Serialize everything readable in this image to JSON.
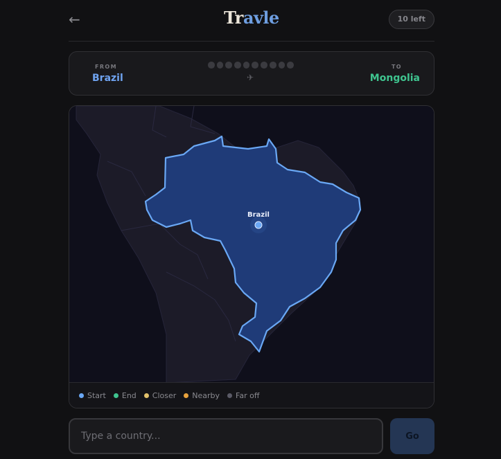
{
  "header": {
    "back_icon": "←",
    "logo_part1": "Tr",
    "logo_part2": "avle",
    "remaining": "10 left"
  },
  "route": {
    "from_label": "FROM",
    "from_value": "Brazil",
    "to_label": "TO",
    "to_value": "Mongolia",
    "guess_slots": 10,
    "plane_icon": "✈"
  },
  "map": {
    "highlight_label": "Brazil",
    "highlight_color": "#6aa8f5"
  },
  "legend": [
    {
      "label": "Start",
      "color": "#6aa8f5"
    },
    {
      "label": "End",
      "color": "#3fc48f"
    },
    {
      "label": "Closer",
      "color": "#e2c16b"
    },
    {
      "label": "Nearby",
      "color": "#e8a23d"
    },
    {
      "label": "Far off",
      "color": "#5a5a66"
    }
  ],
  "input": {
    "placeholder": "Type a country...",
    "value": ""
  },
  "go_button": {
    "label": "Go"
  },
  "colors": {
    "background": "#111113",
    "accent_blue": "#6fa3f0",
    "accent_green": "#3fc48f"
  }
}
